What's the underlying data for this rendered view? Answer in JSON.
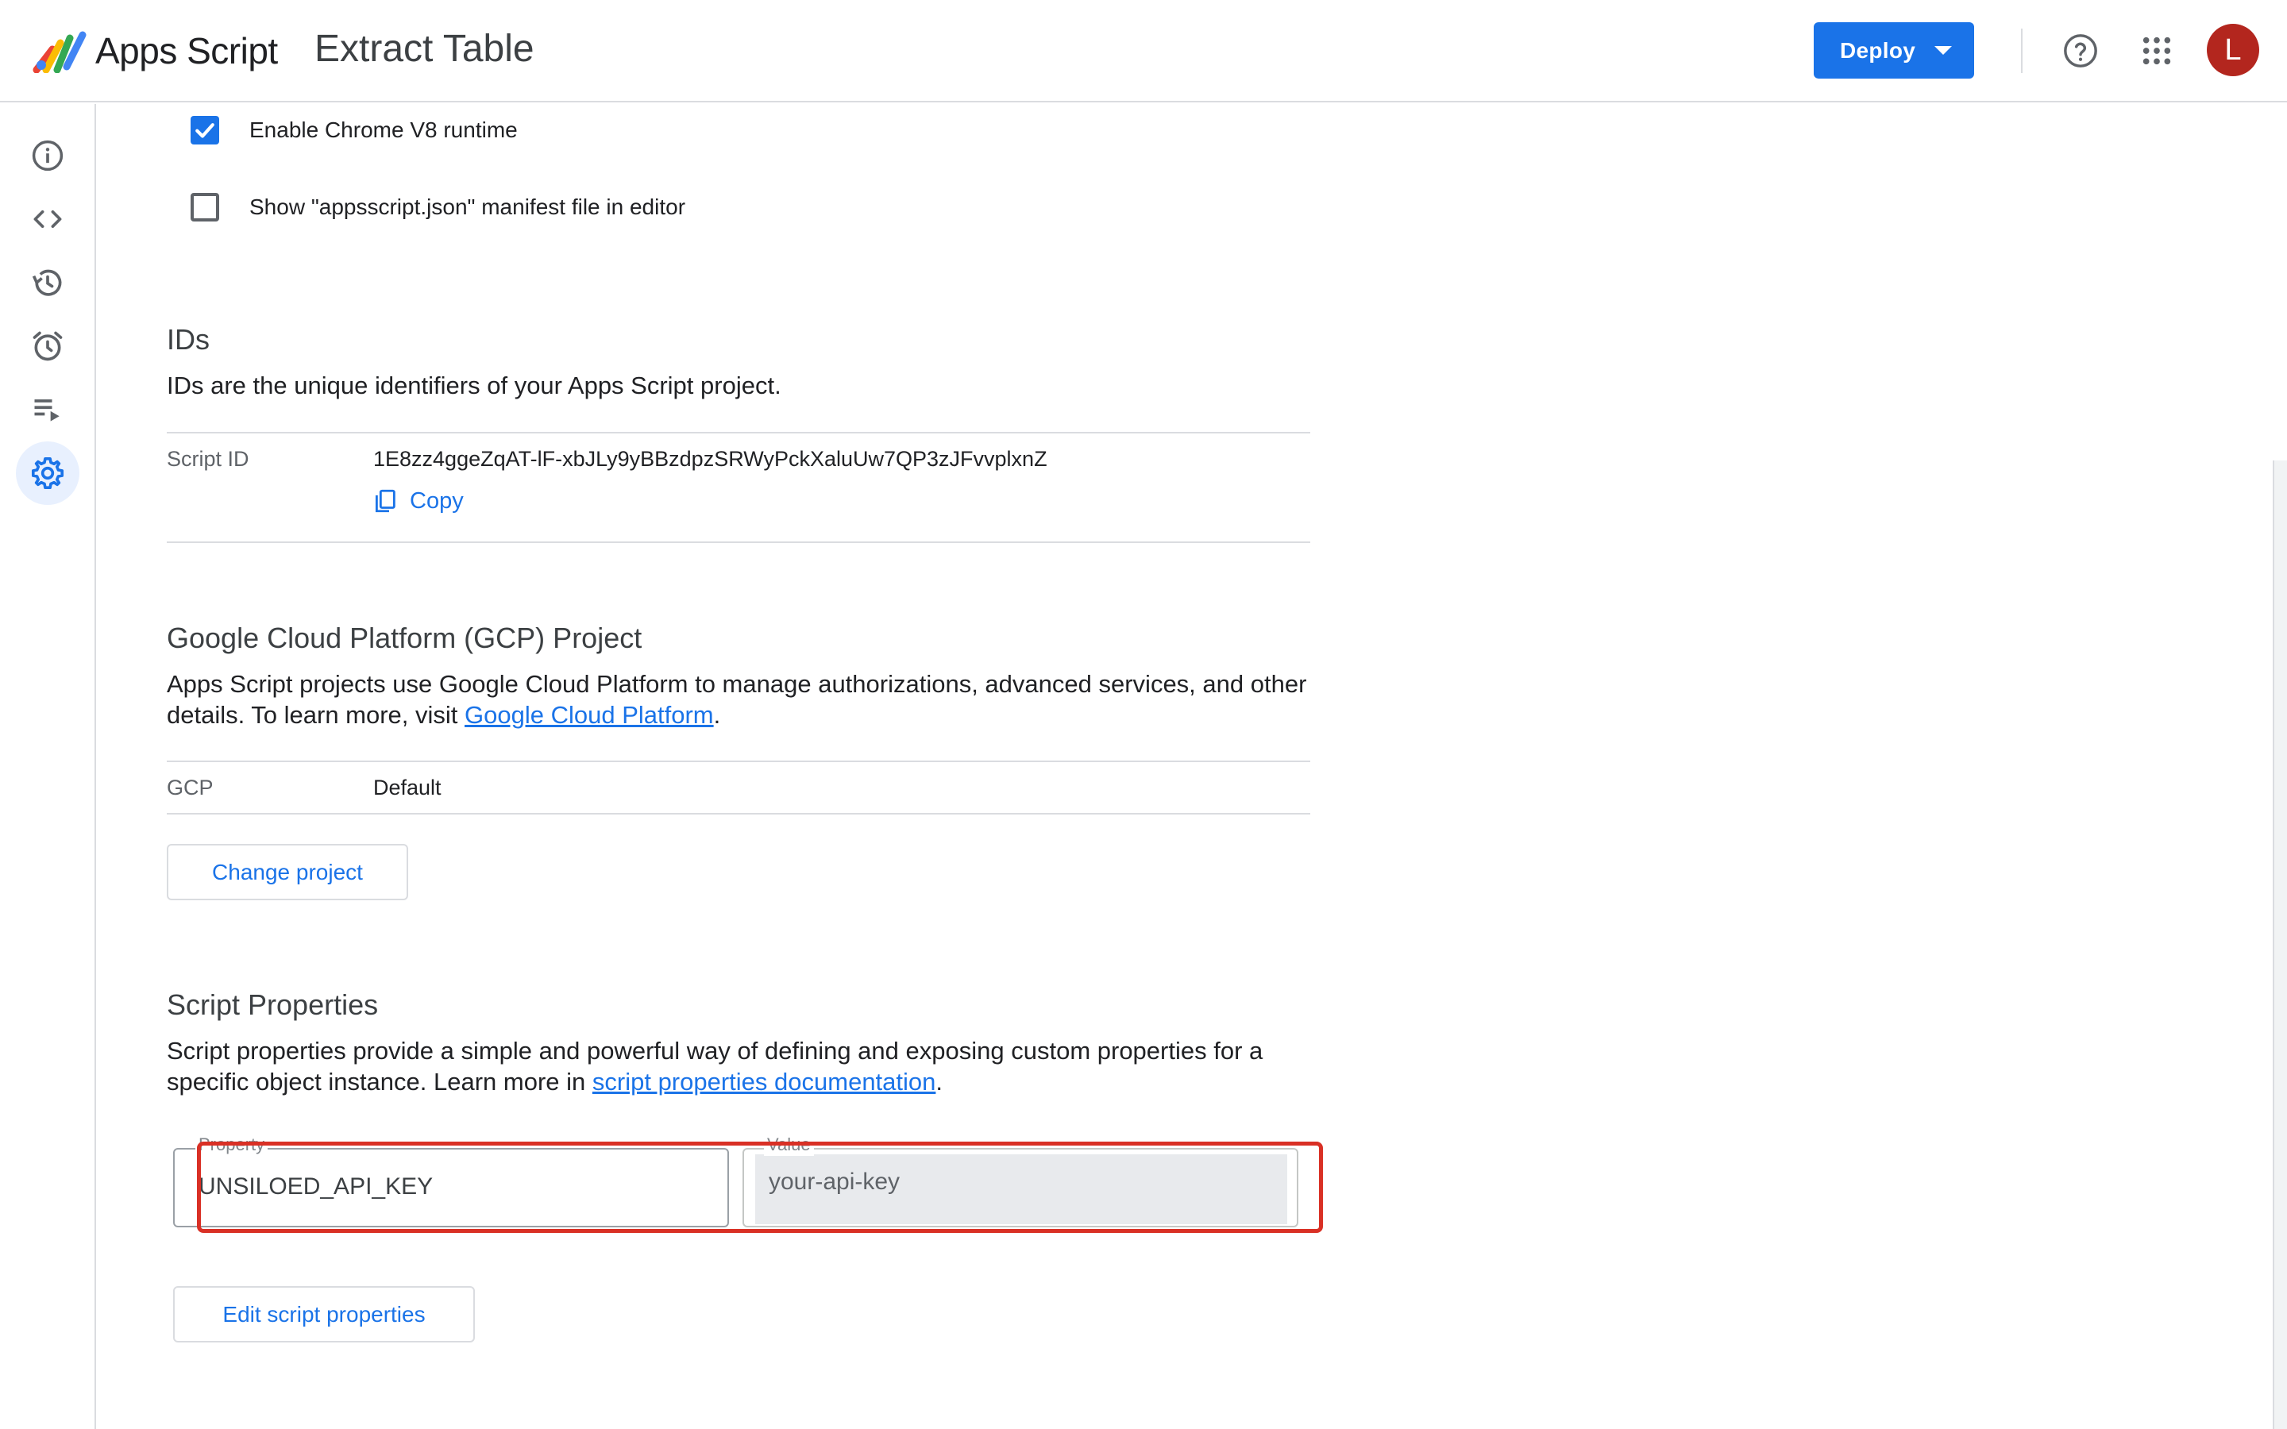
{
  "header": {
    "app_name": "Apps Script",
    "project_title": "Extract Table",
    "deploy_label": "Deploy",
    "avatar_letter": "L",
    "icons": [
      "help-icon",
      "apps-grid-icon"
    ]
  },
  "sidebar": {
    "items": [
      {
        "id": "overview",
        "icon": "info-icon"
      },
      {
        "id": "editor",
        "icon": "code-icon"
      },
      {
        "id": "history",
        "icon": "history-icon"
      },
      {
        "id": "triggers",
        "icon": "alarm-icon"
      },
      {
        "id": "executions",
        "icon": "executions-icon"
      },
      {
        "id": "settings",
        "icon": "gear-icon",
        "active": true
      }
    ]
  },
  "settings": {
    "enable_v8_label": "Enable Chrome V8 runtime",
    "enable_v8_checked": true,
    "show_manifest_label": "Show \"appsscript.json\" manifest file in editor",
    "show_manifest_checked": false
  },
  "ids": {
    "title": "IDs",
    "description": "IDs are the unique identifiers of your Apps Script project.",
    "script_id_label": "Script ID",
    "script_id_value": "1E8zz4ggeZqAT-lF-xbJLy9yBBzdpzSRWyPckXaluUw7QP3zJFvvplxnZ",
    "copy_label": "Copy"
  },
  "gcp": {
    "title": "Google Cloud Platform (GCP) Project",
    "description_prefix": "Apps Script projects use Google Cloud Platform to manage authorizations, advanced services, and other details. To learn more, visit ",
    "link_text": "Google Cloud Platform",
    "description_suffix": ".",
    "gcp_label": "GCP",
    "gcp_value": "Default",
    "change_button": "Change project"
  },
  "script_properties": {
    "title": "Script Properties",
    "description_prefix": "Script properties provide a simple and powerful way of defining and exposing custom properties for a specific object instance. Learn more in ",
    "link_text": "script properties documentation",
    "description_suffix": ".",
    "property_label": "Property",
    "property_value": "UNSILOED_API_KEY",
    "value_label": "Value",
    "value_value": "your-api-key",
    "edit_button": "Edit script properties"
  },
  "colors": {
    "accent": "#1a73e8",
    "avatar": "#b3261e",
    "highlight": "#d93025",
    "active_nav_bg": "#e8f0fe"
  }
}
